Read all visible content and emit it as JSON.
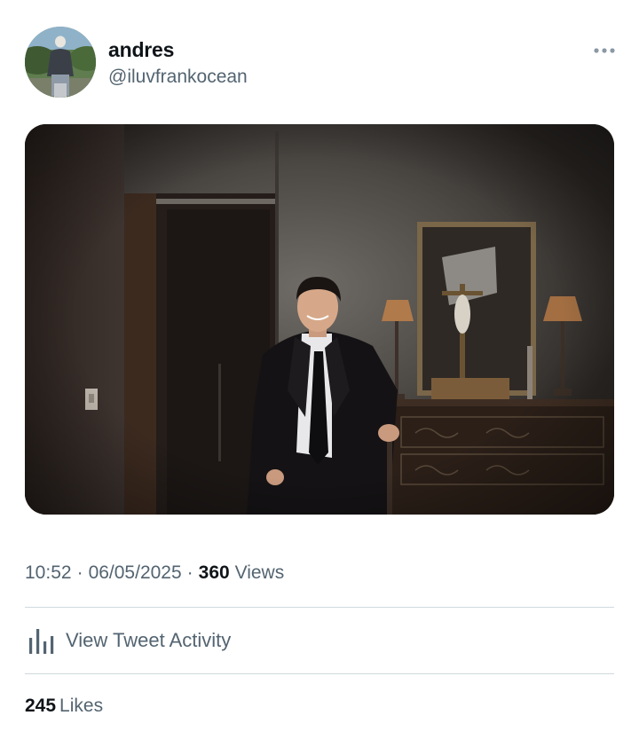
{
  "author": {
    "display_name": "andres",
    "handle": "@iluvfrankocean"
  },
  "icons": {
    "more": "more-horizontal-icon",
    "activity": "bar-chart-icon"
  },
  "meta": {
    "time": "10:52",
    "separator": "·",
    "date": "06/05/2025",
    "views_count": "360",
    "views_label": "Views"
  },
  "activity": {
    "label": "View Tweet Activity"
  },
  "likes": {
    "count": "245",
    "label": "Likes"
  },
  "colors": {
    "text_primary": "#0f1419",
    "text_secondary": "#536471",
    "divider": "#cfd9de"
  }
}
